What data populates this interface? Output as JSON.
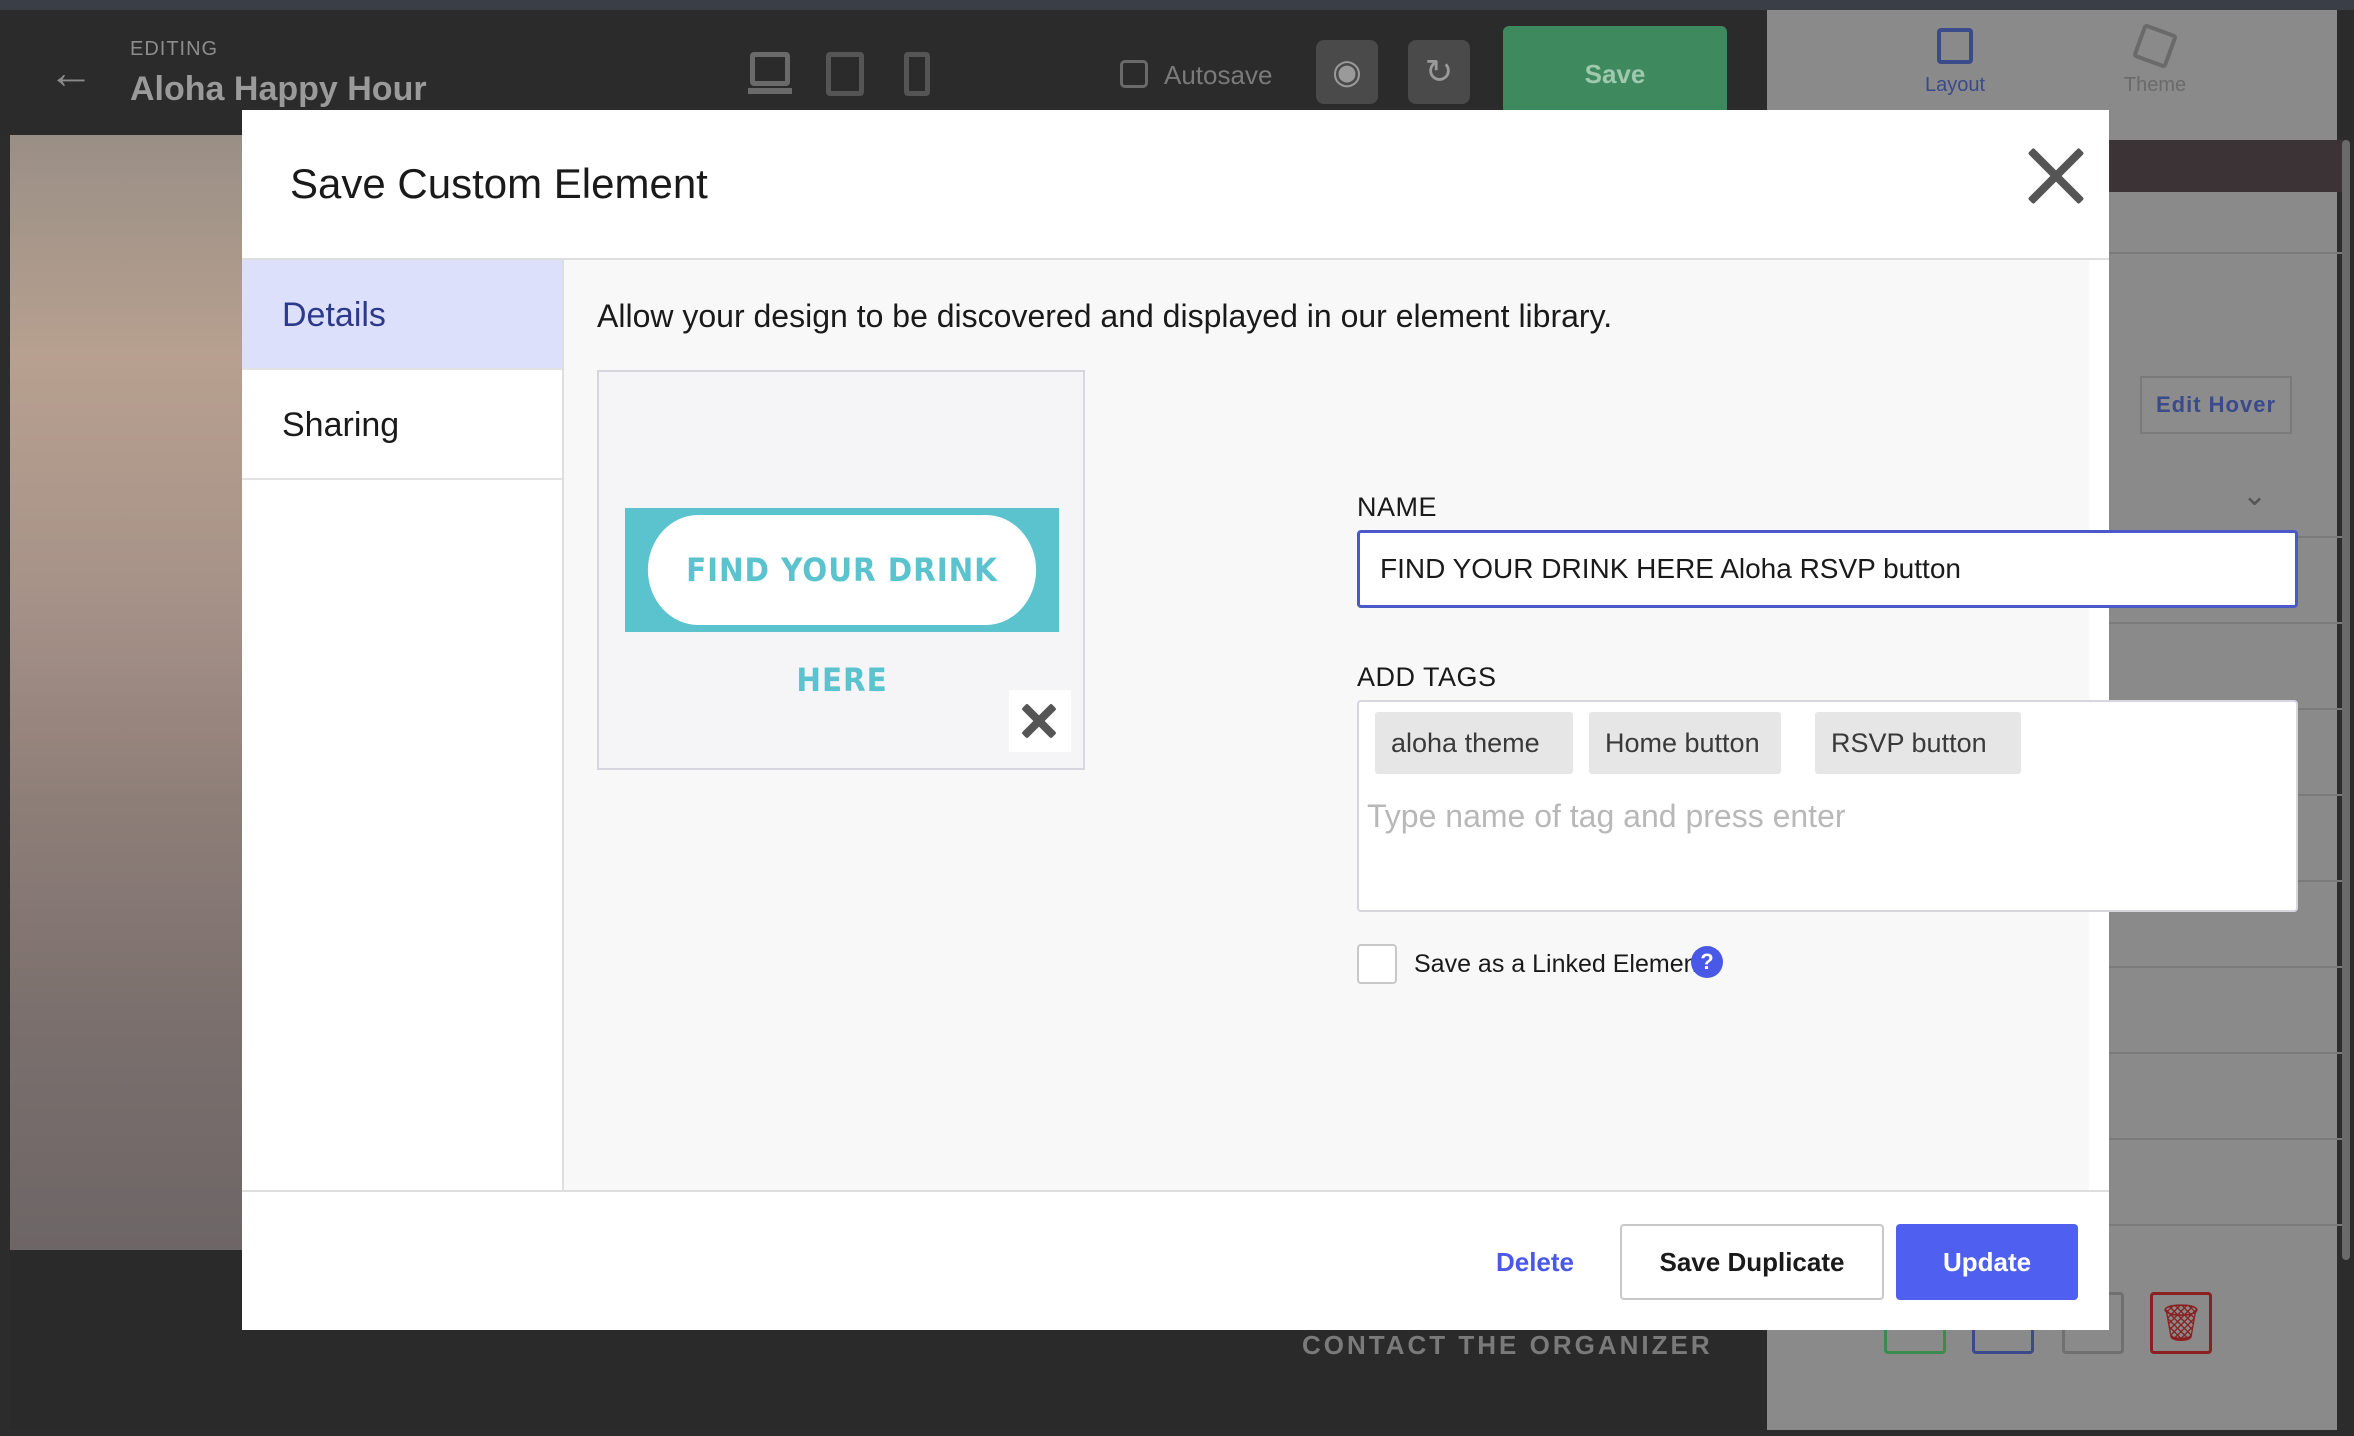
{
  "editor": {
    "editing_label": "EDITING",
    "project_title": "Aloha Happy Hour",
    "autosave_label": "Autosave",
    "save_label": "Save",
    "contact_text": "CONTACT THE ORGANIZER"
  },
  "right_panel": {
    "tabs": [
      {
        "label": "Layout",
        "icon": "layout-icon"
      },
      {
        "label": "Theme",
        "icon": "theme-icon"
      }
    ],
    "edit_hover_label": "Edit Hover"
  },
  "modal": {
    "title": "Save Custom Element",
    "sidebar": {
      "items": [
        {
          "label": "Details",
          "active": true
        },
        {
          "label": "Sharing",
          "active": false
        }
      ]
    },
    "intro_text": "Allow your design to be discovered and displayed in our element library.",
    "preview": {
      "button_text": "FIND YOUR DRINK HERE",
      "button_color": "#5bc3cd"
    },
    "name_label": "NAME",
    "name_value": "FIND YOUR DRINK HERE Aloha RSVP button",
    "tags_label": "ADD TAGS",
    "tags": [
      "aloha theme",
      "Home button",
      "RSVP button"
    ],
    "tag_placeholder": "Type name of tag and press enter",
    "linked_label": "Save as a Linked Element",
    "help_symbol": "?",
    "footer": {
      "delete_label": "Delete",
      "duplicate_label": "Save Duplicate",
      "update_label": "Update"
    },
    "colors": {
      "accent": "#4f5ff0",
      "active_tab_bg": "#dde0fb"
    }
  }
}
